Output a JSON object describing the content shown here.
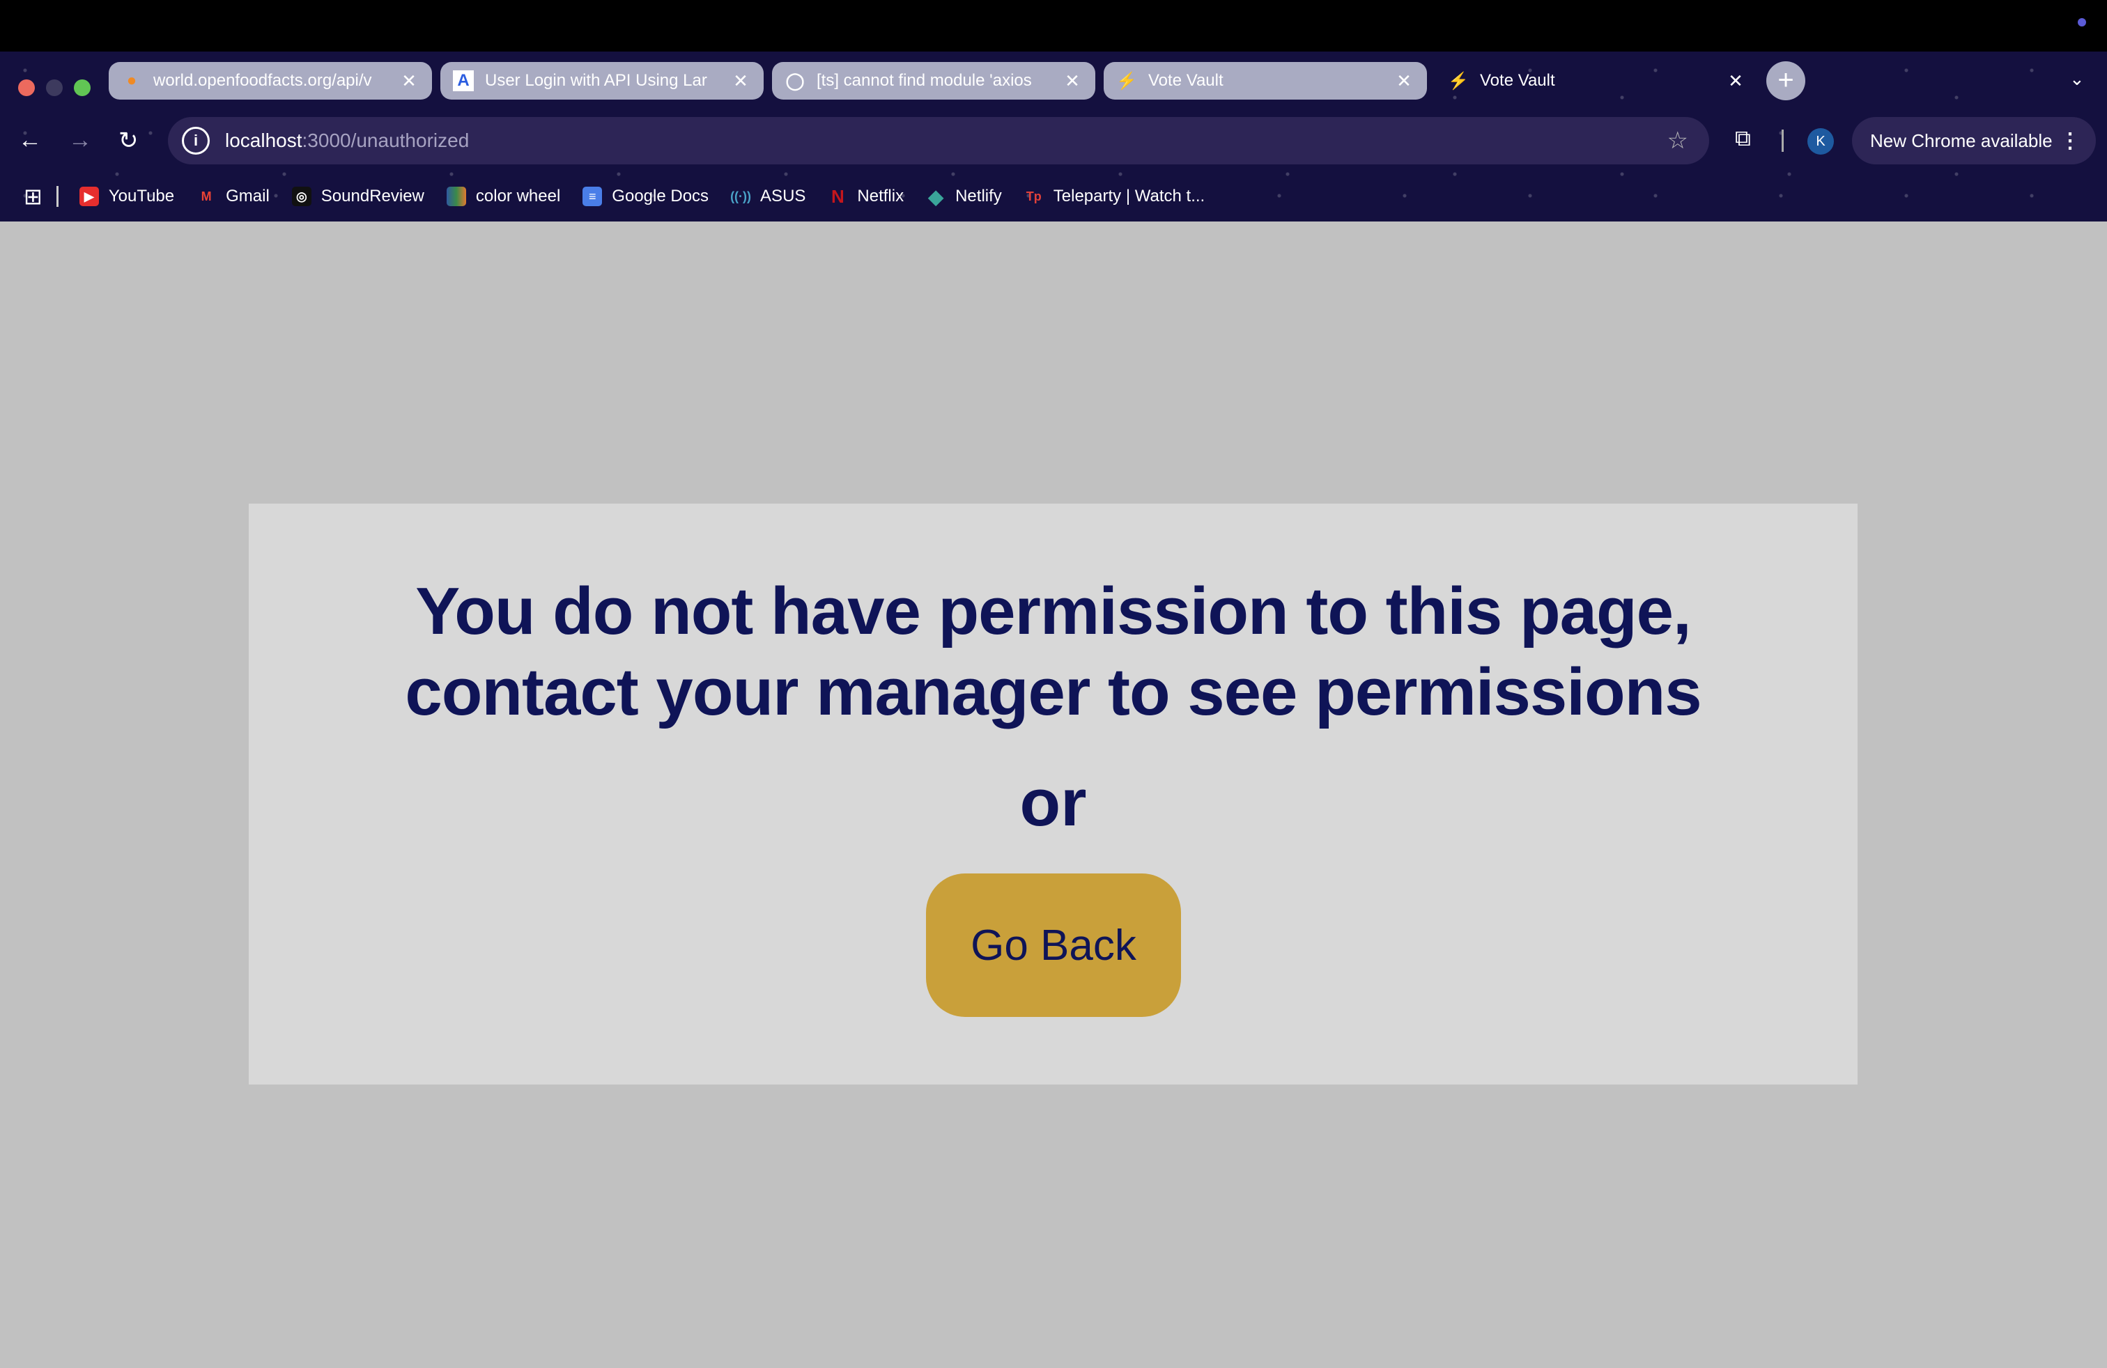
{
  "tabs": [
    {
      "title": "world.openfoodfacts.org/api/v",
      "favicon": "openfoodfacts-icon"
    },
    {
      "title": "User Login with API Using Lar",
      "favicon": "a-logo-icon"
    },
    {
      "title": "[ts] cannot find module 'axios",
      "favicon": "github-icon"
    },
    {
      "title": "Vote Vault",
      "favicon": "vite-icon"
    },
    {
      "title": "Vote Vault",
      "favicon": "vite-icon",
      "active": true
    }
  ],
  "address": {
    "host": "localhost",
    "path": ":3000/unauthorized"
  },
  "profile_initial": "K",
  "update_label": "New Chrome available",
  "bookmarks": [
    {
      "label": "YouTube",
      "color": "#e62e2e"
    },
    {
      "label": "Gmail",
      "color": "#ea4335"
    },
    {
      "label": "SoundReview",
      "color": "#111111"
    },
    {
      "label": "color wheel",
      "color": "#3a7a4a"
    },
    {
      "label": "Google Docs",
      "color": "#4a7ee8"
    },
    {
      "label": "ASUS",
      "color": "#4aa3c8"
    },
    {
      "label": "Netflix",
      "color": "#c4161c"
    },
    {
      "label": "Netlify",
      "color": "#3aa59a"
    },
    {
      "label": "Teleparty | Watch t...",
      "color": "#e0413a"
    }
  ],
  "page": {
    "heading_line1": "You do not have permission to this page,",
    "heading_line2": "contact your manager to see permissions",
    "or": "or",
    "button": "Go Back"
  },
  "colors": {
    "accent": "#c9a03a",
    "text": "#0f1457",
    "card": "#d8d8d8",
    "background": "#c1c1c1"
  }
}
